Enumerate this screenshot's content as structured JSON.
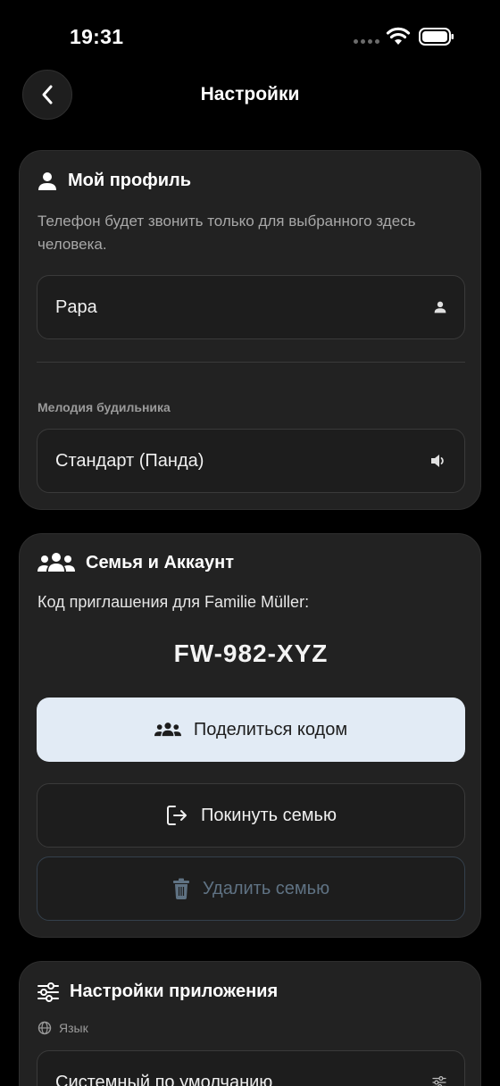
{
  "status_bar": {
    "time": "19:31"
  },
  "nav": {
    "title": "Настройки",
    "back_icon": "chevron-left-icon"
  },
  "profile_card": {
    "title": "Мой профиль",
    "icon": "person-icon",
    "description": "Телефон будет звонить только для выбранного здесь человека.",
    "profile_value": "Papa",
    "profile_icon": "person-icon",
    "ringtone_label": "Мелодия будильника",
    "ringtone_value": "Стандарт (Панда)",
    "ringtone_icon": "speaker-icon"
  },
  "family_card": {
    "title": "Семья и Аккаунт",
    "icon": "group-icon",
    "invite_text": "Код приглашения для Familie Müller:",
    "invite_code": "FW-982-XYZ",
    "share_label": "Поделиться кодом",
    "leave_label": "Покинуть семью",
    "delete_label": "Удалить семью",
    "colors": {
      "share_bg": "#e2ebf5",
      "delete_text": "#5f7283"
    }
  },
  "app_card": {
    "title": "Настройки приложения",
    "icon": "sliders-icon",
    "language_label": "Язык",
    "language_icon": "globe-icon",
    "language_value": "Системный по умолчанию"
  }
}
